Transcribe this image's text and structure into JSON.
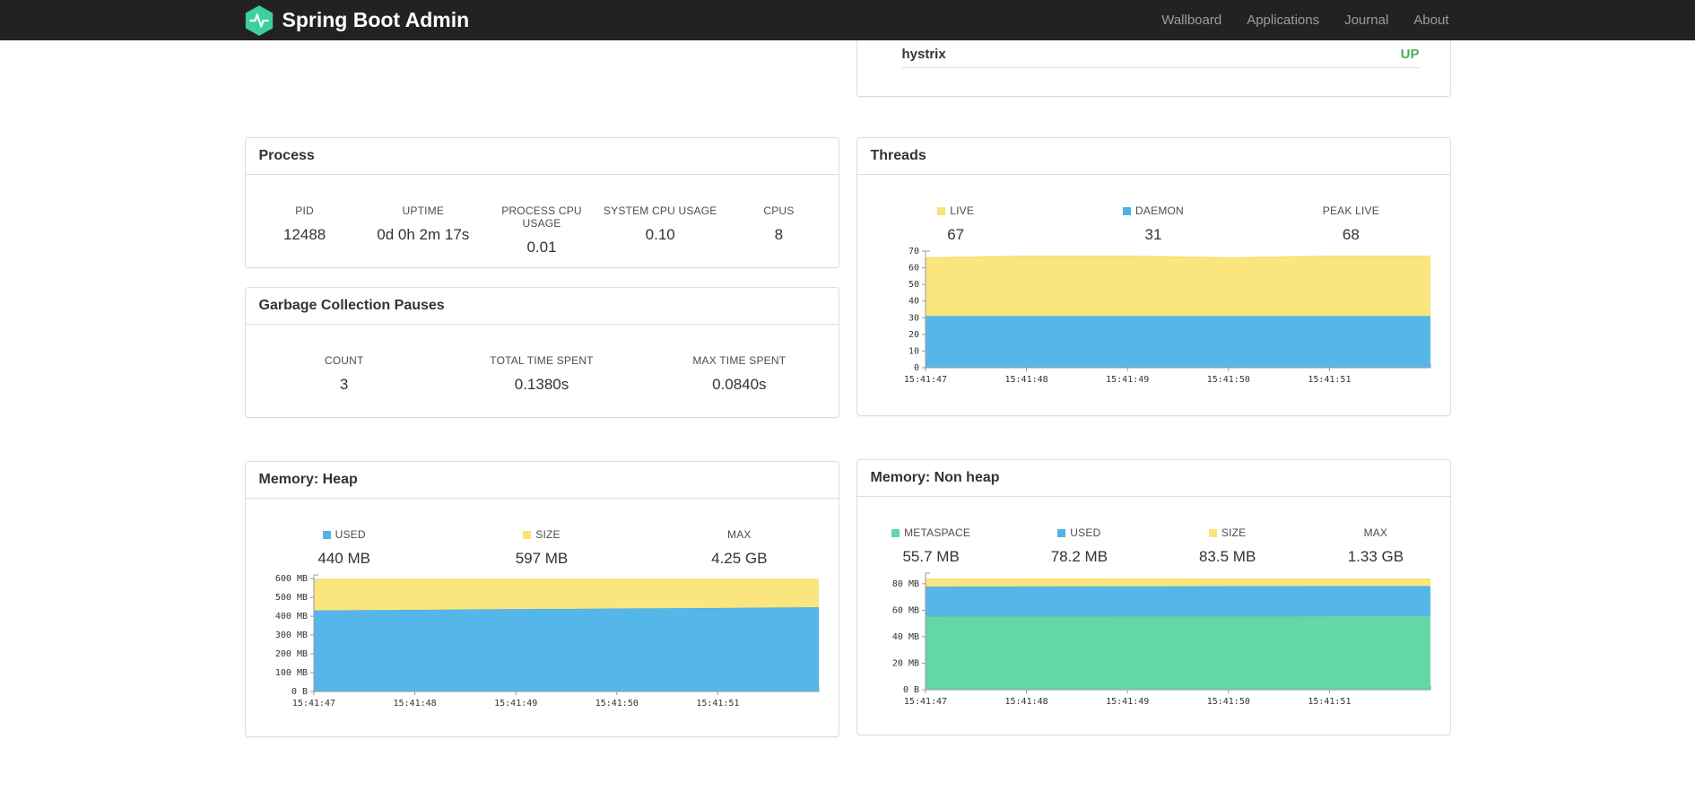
{
  "navbar": {
    "brand": "Spring Boot Admin",
    "links": [
      {
        "label": "Wallboard"
      },
      {
        "label": "Applications"
      },
      {
        "label": "Journal"
      },
      {
        "label": "About"
      }
    ]
  },
  "application_status": {
    "name": "hystrix",
    "status": "UP",
    "status_color": "#4CAF50"
  },
  "process": {
    "title": "Process",
    "stats": [
      {
        "label": "PID",
        "value": "12488"
      },
      {
        "label": "UPTIME",
        "value": "0d 0h 2m 17s"
      },
      {
        "label": "PROCESS CPU USAGE",
        "value": "0.01"
      },
      {
        "label": "SYSTEM CPU USAGE",
        "value": "0.10"
      },
      {
        "label": "CPUS",
        "value": "8"
      }
    ]
  },
  "gc": {
    "title": "Garbage Collection Pauses",
    "stats": [
      {
        "label": "COUNT",
        "value": "3"
      },
      {
        "label": "TOTAL TIME SPENT",
        "value": "0.1380s"
      },
      {
        "label": "MAX TIME SPENT",
        "value": "0.0840s"
      }
    ]
  },
  "threads": {
    "title": "Threads",
    "legend": [
      {
        "label": "LIVE",
        "value": "67",
        "color": "#FBE279"
      },
      {
        "label": "DAEMON",
        "value": "31",
        "color": "#4FB2E8"
      },
      {
        "label": "PEAK LIVE",
        "value": "68"
      }
    ]
  },
  "heap": {
    "title": "Memory: Heap",
    "legend": [
      {
        "label": "USED",
        "value": "440 MB",
        "color": "#4FB2E8"
      },
      {
        "label": "SIZE",
        "value": "597 MB",
        "color": "#FBE279"
      },
      {
        "label": "MAX",
        "value": "4.25 GB"
      }
    ]
  },
  "nonheap": {
    "title": "Memory: Non heap",
    "legend": [
      {
        "label": "METASPACE",
        "value": "55.7 MB",
        "color": "#63D7A7"
      },
      {
        "label": "USED",
        "value": "78.2 MB",
        "color": "#4FB2E8"
      },
      {
        "label": "SIZE",
        "value": "83.5 MB",
        "color": "#FBE279"
      },
      {
        "label": "MAX",
        "value": "1.33 GB"
      }
    ]
  },
  "chart_data": [
    {
      "id": "threads",
      "type": "area",
      "stacked": true,
      "legend_position": "top",
      "grid": false,
      "x_labels": [
        "15:41:47",
        "15:41:48",
        "15:41:49",
        "15:41:50",
        "15:41:51"
      ],
      "ylim": [
        0,
        70
      ],
      "yticks": [
        0,
        10,
        20,
        30,
        40,
        50,
        60,
        70
      ],
      "ytick_labels": [
        "0",
        "10",
        "20",
        "30",
        "40",
        "50",
        "60",
        "70"
      ],
      "series": [
        {
          "name": "DAEMON",
          "color": "#55B7E9",
          "stroke": "#3FA8E0",
          "tops": [
            31,
            31,
            31,
            31,
            31,
            31
          ]
        },
        {
          "name": "LIVE",
          "color": "#FBE57E",
          "stroke": "#F5DA64",
          "tops": [
            66,
            67,
            67,
            66,
            67,
            67
          ]
        }
      ]
    },
    {
      "id": "heap-memory",
      "type": "area",
      "stacked": true,
      "legend_position": "top",
      "grid": false,
      "x_labels": [
        "15:41:47",
        "15:41:48",
        "15:41:49",
        "15:41:50",
        "15:41:51"
      ],
      "ylim": [
        0,
        620
      ],
      "yticks": [
        0,
        100,
        200,
        300,
        400,
        500,
        600
      ],
      "ytick_labels": [
        "0 B",
        "100 MB",
        "200 MB",
        "300 MB",
        "400 MB",
        "500 MB",
        "600 MB"
      ],
      "series": [
        {
          "name": "USED",
          "color": "#55B7E9",
          "stroke": "#3FA8E0",
          "tops": [
            431,
            434,
            438,
            441,
            444,
            448
          ]
        },
        {
          "name": "SIZE",
          "color": "#FBE57E",
          "stroke": "#F5DA64",
          "tops": [
            597,
            597,
            597,
            597,
            597,
            597
          ]
        }
      ]
    },
    {
      "id": "nonheap-memory",
      "type": "area",
      "stacked": true,
      "legend_position": "top",
      "grid": false,
      "x_labels": [
        "15:41:47",
        "15:41:48",
        "15:41:49",
        "15:41:50",
        "15:41:51"
      ],
      "ylim": [
        0,
        88
      ],
      "yticks": [
        0,
        20,
        40,
        60,
        80
      ],
      "ytick_labels": [
        "0 B",
        "20 MB",
        "40 MB",
        "60 MB",
        "80 MB"
      ],
      "series": [
        {
          "name": "METASPACE",
          "color": "#63D7A7",
          "stroke": "#4FC996",
          "tops": [
            55.4,
            55.5,
            55.6,
            55.6,
            55.7,
            55.7
          ]
        },
        {
          "name": "USED",
          "color": "#55B7E9",
          "stroke": "#3FA8E0",
          "tops": [
            77.8,
            77.9,
            78.0,
            78.1,
            78.2,
            78.2
          ]
        },
        {
          "name": "SIZE",
          "color": "#FBE57E",
          "stroke": "#F5DA64",
          "tops": [
            83.5,
            83.5,
            83.5,
            83.5,
            83.5,
            83.5
          ]
        }
      ]
    }
  ]
}
